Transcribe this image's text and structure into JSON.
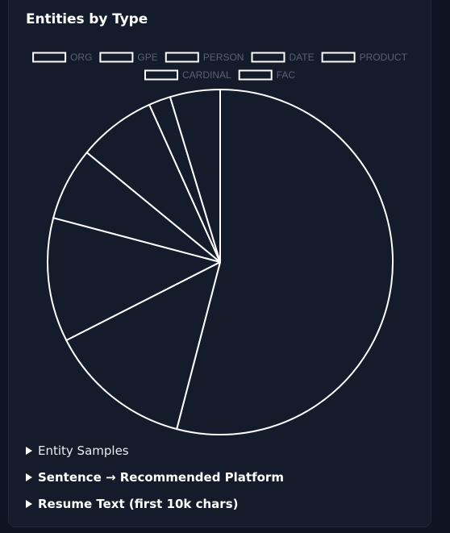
{
  "panel": {
    "samples_label": "Entity Samples",
    "sentence_label": "Sentence → Recommended Platform",
    "resume_label": "Resume Text (first 10k chars)"
  },
  "chart_data": {
    "type": "pie",
    "title": "Entities by Type",
    "labels": [
      "ORG",
      "GPE",
      "PERSON",
      "DATE",
      "PRODUCT",
      "CARDINAL",
      "FAC"
    ],
    "values": [
      55.4,
      13.8,
      11.9,
      7.0,
      7.5,
      2.1,
      4.8
    ],
    "legend_position": "top",
    "slice_fill": "#141b2b",
    "slice_stroke": "#ffffff",
    "legend_text_color": "#5a6170"
  }
}
